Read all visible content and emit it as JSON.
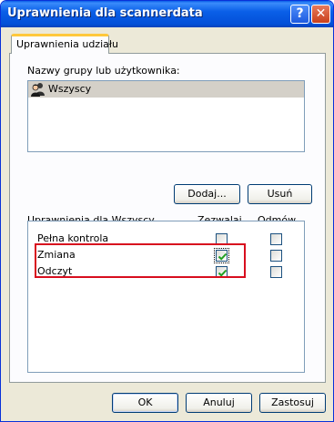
{
  "window": {
    "title": "Uprawnienia dla scannerdata",
    "help_glyph": "?",
    "close_glyph": "✕"
  },
  "tabs": [
    {
      "label": "Uprawnienia udziału",
      "selected": true
    }
  ],
  "groups": {
    "label": "Nazwy grupy lub użytkownika:",
    "items": [
      {
        "name": "Wszyscy",
        "icon": "user-group-icon",
        "selected": true
      }
    ],
    "add_button": "Dodaj...",
    "remove_button": "Usuń"
  },
  "permissions": {
    "header": "Uprawnienia dla Wszyscy",
    "allow_header": "Zezwalaj",
    "deny_header": "Odmów",
    "rows": [
      {
        "name": "Pełna kontrola",
        "allow": false,
        "deny": false
      },
      {
        "name": "Zmiana",
        "allow": true,
        "deny": false
      },
      {
        "name": "Odczyt",
        "allow": true,
        "deny": false
      }
    ],
    "highlight_color": "#d80e1e"
  },
  "footer": {
    "ok": "OK",
    "cancel": "Anuluj",
    "apply": "Zastosuj"
  },
  "colors": {
    "titlebar": "#0a5fe8",
    "dialog_bg": "#ece9d8",
    "check_mark": "#21a121"
  }
}
